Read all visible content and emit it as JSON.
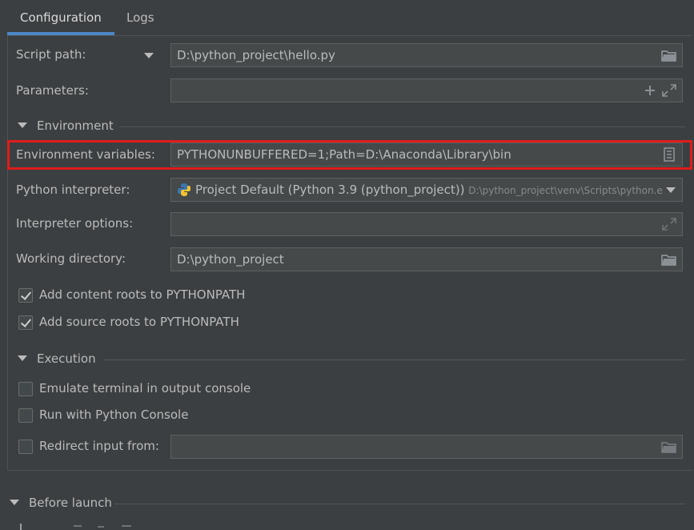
{
  "tabs": [
    {
      "label": "Configuration",
      "active": true
    },
    {
      "label": "Logs",
      "active": false
    }
  ],
  "script_path": {
    "label": "Script path:",
    "value": "D:\\python_project\\hello.py"
  },
  "parameters": {
    "label": "Parameters:",
    "value": ""
  },
  "environment_section": {
    "label": "Environment"
  },
  "env_vars": {
    "label": "Environment variables:",
    "value": "PYTHONUNBUFFERED=1;Path=D:\\Anaconda\\Library\\bin"
  },
  "interpreter": {
    "label": "Python interpreter:",
    "value": "Project Default (Python 3.9 (python_project))",
    "path": "D:\\python_project\\venv\\Scripts\\python.e"
  },
  "interpreter_options": {
    "label": "Interpreter options:",
    "value": ""
  },
  "working_dir": {
    "label": "Working directory:",
    "value": "D:\\python_project"
  },
  "checkboxes": [
    {
      "label": "Add content roots to PYTHONPATH",
      "checked": true
    },
    {
      "label": "Add source roots to PYTHONPATH",
      "checked": true
    }
  ],
  "execution_section": {
    "label": "Execution"
  },
  "execution_options": [
    {
      "label": "Emulate terminal in output console",
      "checked": false
    },
    {
      "label": "Run with Python Console",
      "checked": false
    },
    {
      "label": "Redirect input from:",
      "checked": false,
      "value": ""
    }
  ],
  "before_launch": {
    "label": "Before launch"
  },
  "colors": {
    "accent": "#4a88c7",
    "highlight": "#e01c1c",
    "background": "#3c3f41"
  }
}
